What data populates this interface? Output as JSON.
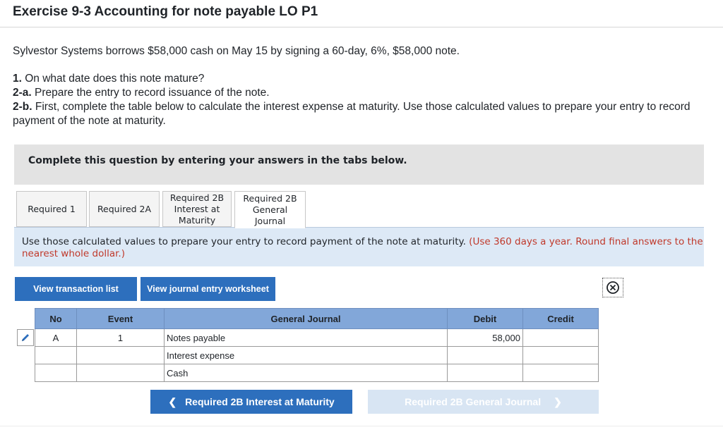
{
  "title": "Exercise 9-3 Accounting for note payable LO P1",
  "intro": "Sylvestor Systems borrows $58,000 cash on May 15 by signing a 60-day, 6%, $58,000 note.",
  "questions": [
    {
      "num": "1.",
      "text": " On what date does this note mature?"
    },
    {
      "num": "2-a.",
      "text": " Prepare the entry to record issuance of the note."
    },
    {
      "num": "2-b.",
      "text": " First, complete the table below to calculate the interest expense at maturity. Use those calculated values to prepare your entry to record payment of the note at maturity."
    }
  ],
  "banner": "Complete this question by entering your answers in the tabs below.",
  "tabs": [
    {
      "label": "Required 1"
    },
    {
      "label": "Required 2A"
    },
    {
      "label": "Required 2B Interest at Maturity"
    },
    {
      "label": "Required 2B General Journal"
    }
  ],
  "instructions": {
    "main": "Use those calculated values to prepare your entry to record payment of the note at maturity. ",
    "note": "(Use 360 days a year. Round final answers to the nearest whole dollar.)"
  },
  "buttons": {
    "transaction_list": "View transaction list",
    "journal_worksheet": "View journal entry worksheet"
  },
  "table": {
    "headers": {
      "no": "No",
      "event": "Event",
      "journal": "General Journal",
      "debit": "Debit",
      "credit": "Credit"
    },
    "rows": [
      {
        "no": "A",
        "event": "1",
        "account": "Notes payable",
        "debit": "58,000",
        "credit": ""
      },
      {
        "no": "",
        "event": "",
        "account": "Interest expense",
        "debit": "",
        "credit": ""
      },
      {
        "no": "",
        "event": "",
        "account": "Cash",
        "debit": "",
        "credit": ""
      }
    ]
  },
  "nav": {
    "prev_label": "Required 2B Interest at Maturity",
    "next_label": "Required 2B General Journal"
  },
  "colors": {
    "accent": "#2d6fbd",
    "header": "#82a7d9",
    "note_red": "#c0392b"
  }
}
